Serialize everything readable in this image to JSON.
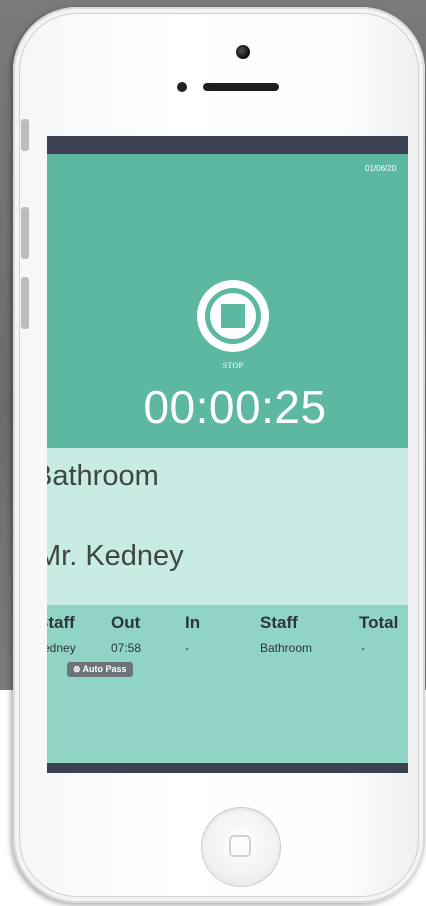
{
  "status_bar": {
    "date": "01/06/20"
  },
  "timer": {
    "stop_label": "STOP",
    "elapsed": "00:00:25"
  },
  "pass": {
    "location": "Bathroom",
    "teacher": "Mr. Kedney"
  },
  "log_table": {
    "headers": [
      "Staff",
      "Out",
      "In",
      "Staff",
      "Total"
    ],
    "rows": [
      {
        "staff": "Kedney",
        "out": "07:58",
        "in": "-",
        "staff2": "Bathroom",
        "total": "-",
        "badge": "Auto Pass",
        "badge_icon": "⊗"
      }
    ]
  },
  "colors": {
    "hero": "#5cb8a0",
    "info_panel": "#c8ebe3",
    "table_bg": "#8fd4c5",
    "bars": "#3b4150",
    "badge": "#6d7478"
  }
}
